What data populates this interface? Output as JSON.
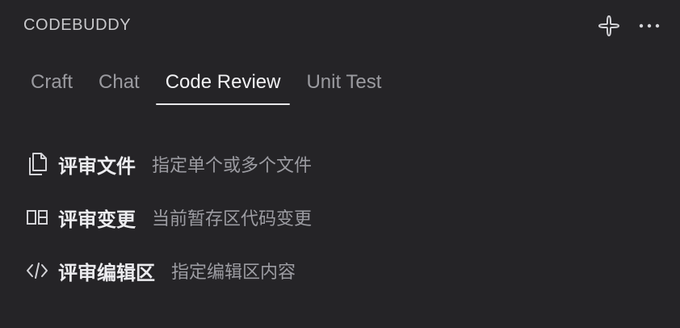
{
  "header": {
    "title": "CODEBUDDY",
    "actions": [
      {
        "icon": "sparkle-cross-icon"
      },
      {
        "icon": "more-horizontal-icon"
      }
    ]
  },
  "tabs": [
    {
      "label": "Craft",
      "active": false
    },
    {
      "label": "Chat",
      "active": false
    },
    {
      "label": "Code Review",
      "active": true
    },
    {
      "label": "Unit Test",
      "active": false
    }
  ],
  "review_actions": [
    {
      "icon": "files-icon",
      "label": "评审文件",
      "description": "指定单个或多个文件"
    },
    {
      "icon": "diff-compare-icon",
      "label": "评审变更",
      "description": "当前暂存区代码变更"
    },
    {
      "icon": "code-brackets-icon",
      "label": "评审编辑区",
      "description": "指定编辑区内容"
    }
  ],
  "colors": {
    "background": "#252427",
    "text_primary": "#ececef",
    "text_secondary": "#9c9ca2",
    "tab_underline": "#e8e8ea"
  }
}
